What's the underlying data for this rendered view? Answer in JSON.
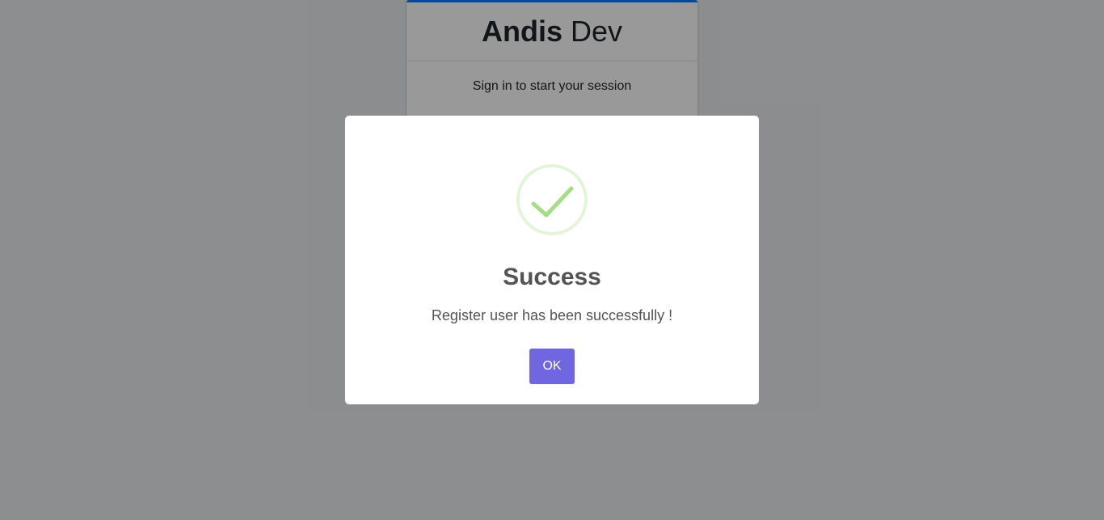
{
  "login": {
    "brand_bold": "Andis",
    "brand_light": "Dev",
    "message": "Sign in to start your session"
  },
  "modal": {
    "icon": "success-check-icon",
    "title": "Success",
    "text": "Register user has been successfully !",
    "confirm_label": "OK",
    "confirm_color": "#7066e0",
    "icon_color": "#a5dc86"
  }
}
